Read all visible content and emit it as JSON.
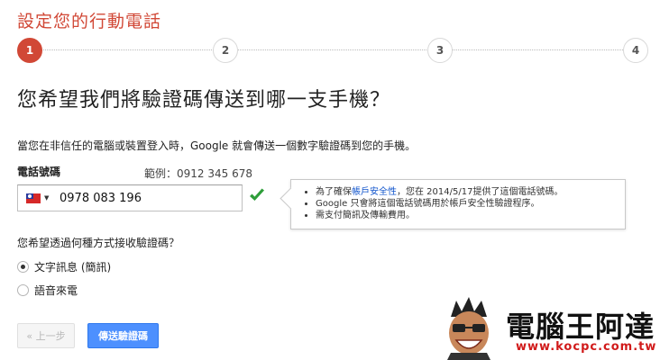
{
  "page": {
    "title": "設定您的行動電話"
  },
  "stepper": {
    "steps": [
      "1",
      "2",
      "3",
      "4"
    ],
    "active": 1
  },
  "main": {
    "heading": "您希望我們將驗證碼傳送到哪一支手機？",
    "description": "當您在非信任的電腦或裝置登入時，Google 就會傳送一個數字驗證碼到您的手機。"
  },
  "phone": {
    "label": "電話號碼",
    "example": "範例：0912 345 678",
    "value": "0978 083 196",
    "country_icon": "taiwan-flag-icon"
  },
  "info": {
    "line1_prefix": "為了確保",
    "line1_link": "帳戶安全性",
    "line1_suffix": "，您在 2014/5/17提供了這個電話號碼。",
    "line2": "Google 只會將這個電話號碼用於帳戶安全性驗證程序。",
    "line3": "需支付簡訊及傳輸費用。",
    "link_color": "#1155cc"
  },
  "method": {
    "question": "您希望透過何種方式接收驗證碼？",
    "options": [
      {
        "label": "文字訊息 (簡訊)",
        "selected": true
      },
      {
        "label": "語音來電",
        "selected": false
      }
    ]
  },
  "buttons": {
    "back": "« 上一步",
    "send": "傳送驗證碼"
  },
  "watermark": {
    "brand": "電腦王阿達",
    "url": "www.kocpc.com.tw"
  },
  "colors": {
    "accent_red": "#d14836",
    "primary_blue": "#4d90fe",
    "check_green": "#2e9e3a"
  }
}
